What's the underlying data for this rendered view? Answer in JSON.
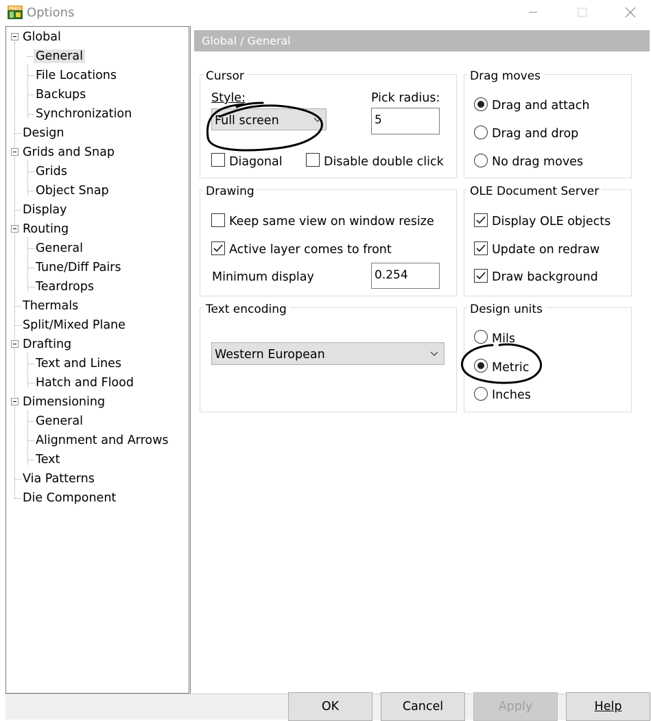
{
  "window": {
    "title": "Options",
    "icon": "pads-app-icon",
    "controls": [
      "minimize-icon",
      "maximize-icon",
      "close-icon"
    ]
  },
  "tree": {
    "items": [
      {
        "label": "Global",
        "level": 0,
        "expanded": true
      },
      {
        "label": "General",
        "level": 1,
        "selected": true
      },
      {
        "label": "File Locations",
        "level": 1
      },
      {
        "label": "Backups",
        "level": 1
      },
      {
        "label": "Synchronization",
        "level": 1
      },
      {
        "label": "Design",
        "level": 0
      },
      {
        "label": "Grids and Snap",
        "level": 0,
        "expanded": true
      },
      {
        "label": "Grids",
        "level": 1
      },
      {
        "label": "Object Snap",
        "level": 1
      },
      {
        "label": "Display",
        "level": 0
      },
      {
        "label": "Routing",
        "level": 0,
        "expanded": true
      },
      {
        "label": "General",
        "level": 1
      },
      {
        "label": "Tune/Diff Pairs",
        "level": 1
      },
      {
        "label": "Teardrops",
        "level": 1
      },
      {
        "label": "Thermals",
        "level": 0
      },
      {
        "label": "Split/Mixed Plane",
        "level": 0
      },
      {
        "label": "Drafting",
        "level": 0,
        "expanded": true
      },
      {
        "label": "Text and Lines",
        "level": 1
      },
      {
        "label": "Hatch and Flood",
        "level": 1
      },
      {
        "label": "Dimensioning",
        "level": 0,
        "expanded": true
      },
      {
        "label": "General",
        "level": 1
      },
      {
        "label": "Alignment and Arrows",
        "level": 1
      },
      {
        "label": "Text",
        "level": 1
      },
      {
        "label": "Via Patterns",
        "level": 0
      },
      {
        "label": "Die Component",
        "level": 0
      }
    ]
  },
  "page": {
    "header": "Global / General",
    "cursor": {
      "title": "Cursor",
      "style_label": "Style:",
      "style_value": "Full screen",
      "pick_radius_label": "Pick radius:",
      "pick_radius_value": "5",
      "diagonal_label": "Diagonal",
      "diagonal_checked": false,
      "disable_double_click_label": "Disable double click",
      "disable_double_click_checked": false
    },
    "drag_moves": {
      "title": "Drag moves",
      "options": [
        "Drag and attach",
        "Drag and drop",
        "No drag moves"
      ],
      "selected": "Drag and attach"
    },
    "drawing": {
      "title": "Drawing",
      "keep_same_view_label": "Keep same view on window resize",
      "keep_same_view_checked": false,
      "active_layer_label": "Active layer comes to front",
      "active_layer_checked": true,
      "minimum_display_label": "Minimum display",
      "minimum_display_value": "0.254"
    },
    "ole": {
      "title": "OLE Document Server",
      "display_objects_label": "Display OLE objects",
      "display_objects_checked": true,
      "update_on_redraw_label": "Update on redraw",
      "update_on_redraw_checked": true,
      "draw_background_label": "Draw background",
      "draw_background_checked": true
    },
    "text_encoding": {
      "title": "Text encoding",
      "value": "Western European"
    },
    "design_units": {
      "title": "Design units",
      "options": [
        "Mils",
        "Metric",
        "Inches"
      ],
      "selected": "Metric"
    }
  },
  "buttons": {
    "ok": "OK",
    "cancel": "Cancel",
    "apply": "Apply",
    "help": "Help"
  }
}
